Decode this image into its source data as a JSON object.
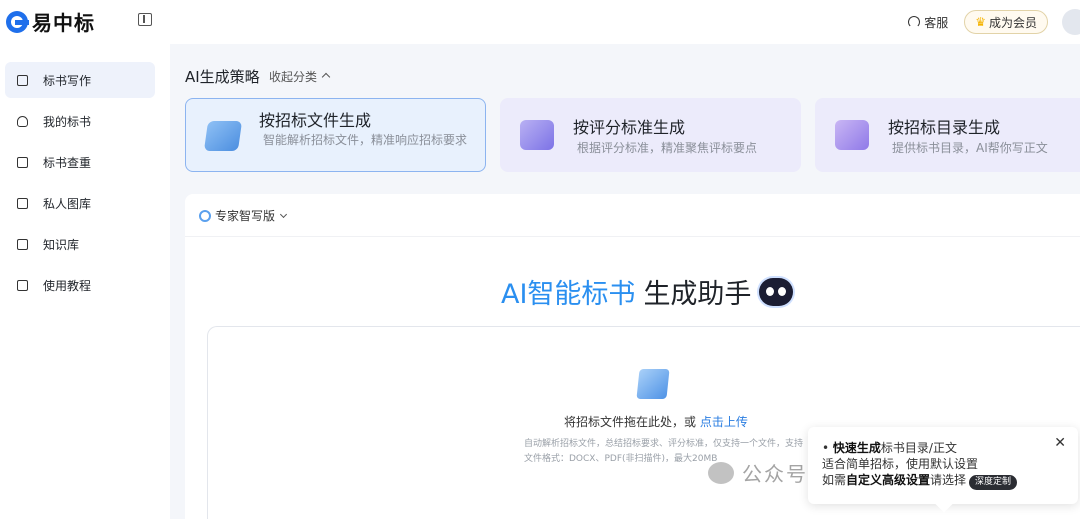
{
  "header": {
    "logo_text": "易中标",
    "service_label": "客服",
    "vip_label": "成为会员"
  },
  "sidebar": {
    "items": [
      {
        "label": "标书写作",
        "icon": "book-icon",
        "active": true
      },
      {
        "label": "我的标书",
        "icon": "user-icon",
        "active": false
      },
      {
        "label": "标书查重",
        "icon": "check-doc-icon",
        "active": false
      },
      {
        "label": "私人图库",
        "icon": "gallery-icon",
        "active": false
      },
      {
        "label": "知识库",
        "icon": "folder-icon",
        "active": false
      },
      {
        "label": "使用教程",
        "icon": "tutorial-icon",
        "active": false
      }
    ]
  },
  "strategy": {
    "title": "AI生成策略",
    "collapse_label": "收起分类"
  },
  "cards": [
    {
      "title": "按招标文件生成",
      "desc": "智能解析招标文件，精准响应招标要求",
      "icon": "folder-icon"
    },
    {
      "title": "按评分标准生成",
      "desc": "根据评分标准，精准聚焦评标要点",
      "icon": "checklist-icon"
    },
    {
      "title": "按招标目录生成",
      "desc": "提供标书目录，AI帮你写正文",
      "icon": "search-doc-icon"
    }
  ],
  "panel": {
    "mode_label": "专家智写版",
    "hero_part1": "AI智能标书",
    "hero_part2": "生成助手",
    "upload_text": "将招标文件拖在此处，或",
    "upload_link": "点击上传",
    "upload_hint": "自动解析招标文件，总结招标要求、评分标准，仅支持一个文件，支持文件格式：DOCX、PDF(非扫描件)，最大20MB"
  },
  "tooltip": {
    "line1_bold": "快速生成",
    "line1_rest": "标书目录/正文",
    "line2": "适合简单招标，使用默认设置",
    "line3_pre": "如需",
    "line3_bold": "自定义高级设置",
    "line3_post": "请选择",
    "badge": "深度定制"
  },
  "watermark": {
    "text": "公众号 · 水木生姿科技界"
  },
  "colors": {
    "accent": "#2a8ff0",
    "active_nav_bg": "#eef2fb",
    "card_selected_bg": "#e8f1fd",
    "card_bg": "#ecebfb"
  }
}
